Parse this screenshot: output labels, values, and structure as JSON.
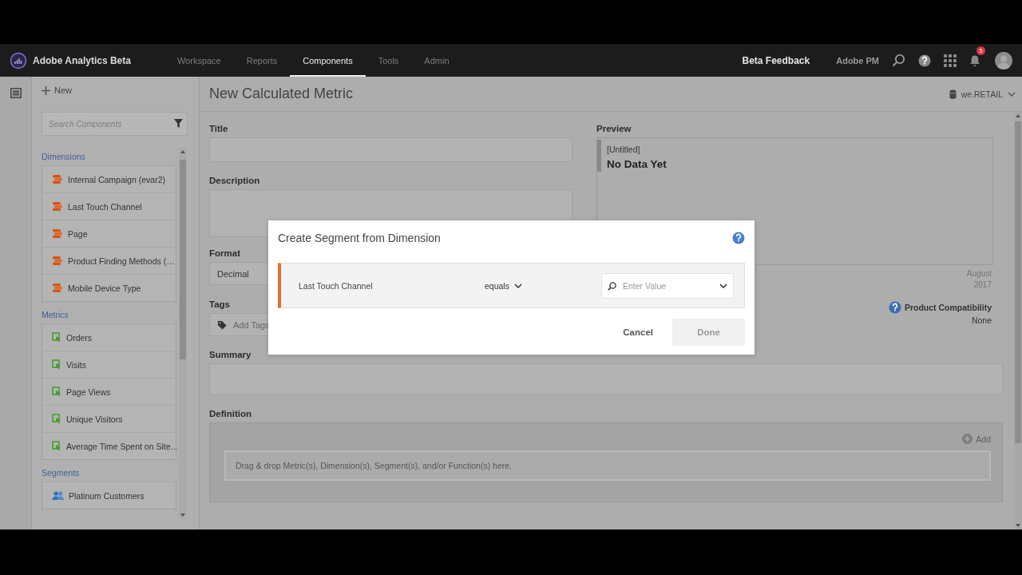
{
  "app": {
    "name": "Adobe Analytics Beta"
  },
  "nav": [
    {
      "label": "Workspace",
      "selected": false
    },
    {
      "label": "Reports",
      "selected": false
    },
    {
      "label": "Components",
      "selected": true
    },
    {
      "label": "Tools",
      "selected": false
    },
    {
      "label": "Admin",
      "selected": false
    }
  ],
  "header_right": {
    "feedback": "Beta Feedback",
    "user": "Adobe PM",
    "notification_count": "5"
  },
  "panel": {
    "new_label": "New",
    "search_placeholder": "Search Components",
    "sections": [
      {
        "title": "Dimensions",
        "kind": "dimension",
        "items": [
          "Internal Campaign (evar2)",
          "Last Touch Channel",
          "Page",
          "Product Finding Methods (…",
          "Mobile Device Type"
        ]
      },
      {
        "title": "Metrics",
        "kind": "metric",
        "items": [
          "Orders",
          "Visits",
          "Page Views",
          "Unique Visitors",
          "Average Time Spent on Site…"
        ]
      },
      {
        "title": "Segments",
        "kind": "segment",
        "items": [
          "Platinum Customers"
        ]
      }
    ]
  },
  "page": {
    "title": "New Calculated Metric",
    "report_suite": "we.RETAIL"
  },
  "form": {
    "title_label": "Title",
    "description_label": "Description",
    "format_label": "Format",
    "format_value": "Decimal",
    "tags_label": "Tags",
    "tags_placeholder": "Add Tags",
    "summary_label": "Summary",
    "definition_label": "Definition",
    "add_label": "Add",
    "drop_hint": "Drag & drop Metric(s), Dimension(s), Segment(s), and/or Function(s) here."
  },
  "preview": {
    "label": "Preview",
    "metric_title": "[Untitled]",
    "value": "No Data Yet",
    "date_month": "August",
    "date_year": "2017",
    "compatibility_label": "Product Compatibility",
    "compatibility_value": "None"
  },
  "dialog": {
    "title": "Create Segment from Dimension",
    "dimension": "Last Touch Channel",
    "operator": "equals",
    "value_placeholder": "Enter Value",
    "buttons": [
      {
        "label": "Cancel",
        "disabled": false
      },
      {
        "label": "Done",
        "disabled": true
      }
    ]
  }
}
